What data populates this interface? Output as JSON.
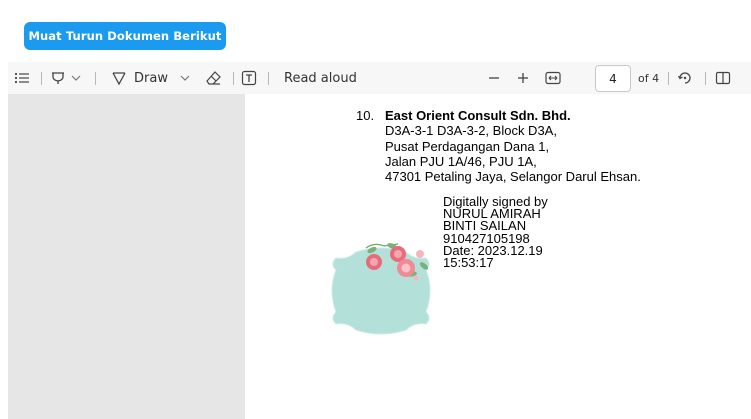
{
  "header": {
    "download_label": "Muat Turun Dokumen Berikut"
  },
  "toolbar": {
    "draw_label": "Draw",
    "read_aloud_label": "Read aloud",
    "page_current": "4",
    "page_total_label": "of 4"
  },
  "document": {
    "item_number": "10.",
    "company": "East Orient Consult Sdn. Bhd.",
    "address_lines": [
      "D3A-3-1  D3A-3-2, Block D3A,",
      "Pusat Perdagangan Dana 1,",
      "Jalan PJU 1A/46, PJU 1A,",
      "47301 Petaling Jaya, Selangor Darul Ehsan."
    ],
    "signature_lines": [
      "Digitally signed by",
      "NURUL AMIRAH",
      "BINTI SAILAN",
      "910427105198",
      "Date: 2023.12.19",
      "15:53:17"
    ]
  },
  "colors": {
    "accent": "#1a9bf0",
    "sidebar": "#e6e6e6",
    "toolbar": "#f7f7f7",
    "seal_fill": "#b3e0d8"
  },
  "icons": [
    "contents-icon",
    "highlight-icon",
    "chevron-down-icon",
    "draw-icon",
    "eraser-icon",
    "text-box-icon",
    "zoom-out-icon",
    "zoom-in-icon",
    "fit-width-icon",
    "rotate-icon",
    "two-page-view-icon"
  ]
}
